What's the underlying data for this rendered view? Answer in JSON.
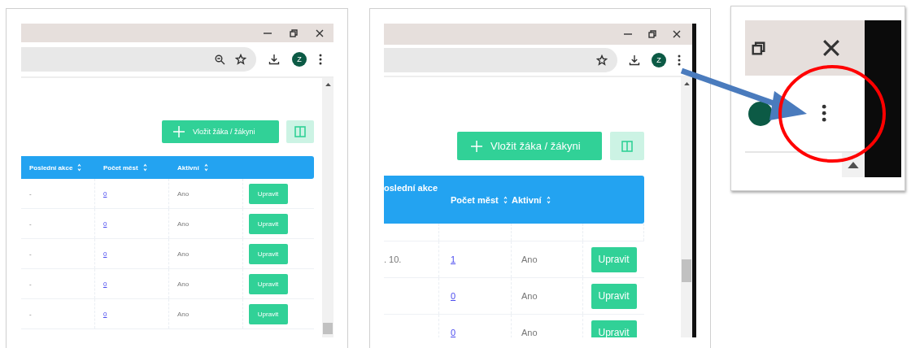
{
  "windows": [
    {
      "kind": "page-top",
      "zoom_indicator": true,
      "avatar": "Z",
      "add_button": "Vložit žáka / žákyni",
      "columns": [
        {
          "label": "Poslední akce",
          "sortable": true
        },
        {
          "label": "Počet měst",
          "sortable": true
        },
        {
          "label": "Aktivní",
          "sortable": true
        }
      ],
      "rows": [
        {
          "last_action": "-",
          "cities": "0",
          "active": "Ano",
          "button": "Upravit"
        },
        {
          "last_action": "-",
          "cities": "0",
          "active": "Ano",
          "button": "Upravit"
        },
        {
          "last_action": "-",
          "cities": "0",
          "active": "Ano",
          "button": "Upravit"
        },
        {
          "last_action": "-",
          "cities": "0",
          "active": "Ano",
          "button": "Upravit"
        },
        {
          "last_action": "-",
          "cities": "0",
          "active": "Ano",
          "button": "Upravit"
        }
      ]
    },
    {
      "kind": "page-scrolled",
      "zoom_indicator": false,
      "avatar": "Z",
      "add_button": "Vložit žáka / žákyni",
      "columns": [
        {
          "label": "oslední akce"
        },
        {
          "label": "Počet měst",
          "sortable": true
        },
        {
          "label": "Aktivní",
          "sortable": true
        }
      ],
      "rows": [
        {
          "last_action": ". 10.",
          "cities": "1",
          "active": "Ano",
          "button": "Upravit"
        },
        {
          "cities": "0",
          "active": "Ano",
          "button": "Upravit"
        },
        {
          "cities": "0",
          "active": "Ano",
          "button": "Upravit"
        }
      ]
    },
    {
      "kind": "closeup"
    }
  ],
  "annotations": [
    {
      "kind": "arrow"
    },
    {
      "kind": "circle"
    }
  ]
}
